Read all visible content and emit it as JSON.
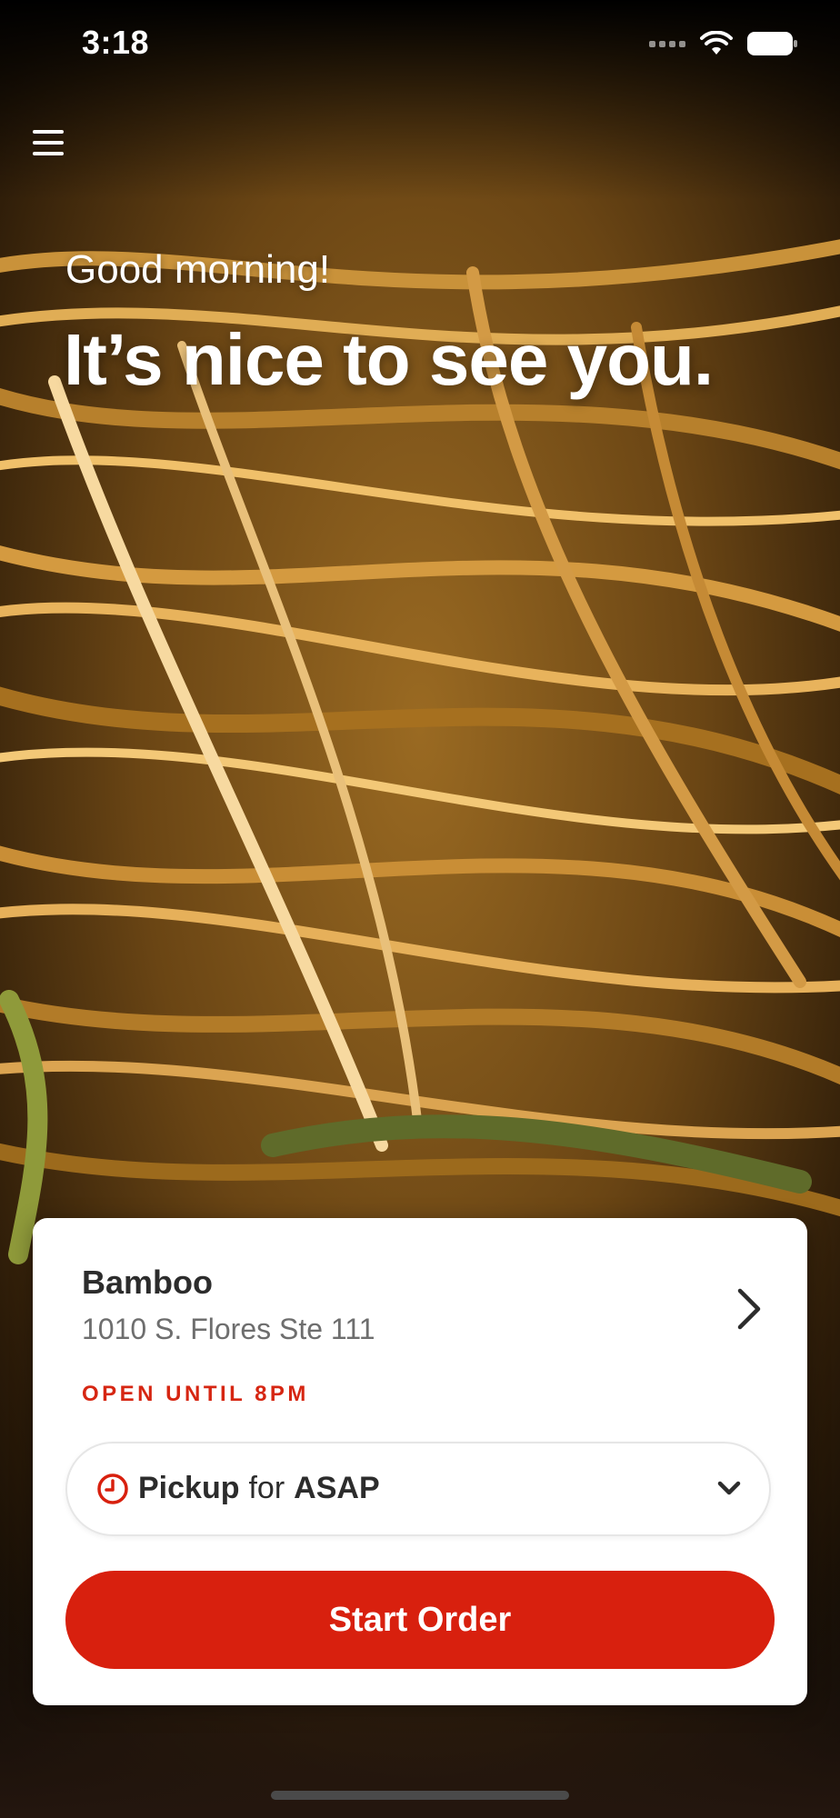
{
  "status_bar": {
    "time": "3:18"
  },
  "header": {
    "greeting": "Good morning!",
    "headline": "It’s nice to see you."
  },
  "location": {
    "name": "Bamboo",
    "address": "1010 S. Flores Ste 111",
    "open_status": "OPEN UNTIL 8PM"
  },
  "order_mode": {
    "mode": "Pickup",
    "connector": "for",
    "time": "ASAP"
  },
  "actions": {
    "start_order": "Start Order"
  },
  "colors": {
    "accent": "#d8200e",
    "status_text": "#d62612"
  },
  "icons": {
    "menu": "hamburger-menu-icon",
    "location_chevron": "chevron-right-icon",
    "clock": "clock-icon",
    "dropdown": "chevron-down-icon"
  }
}
